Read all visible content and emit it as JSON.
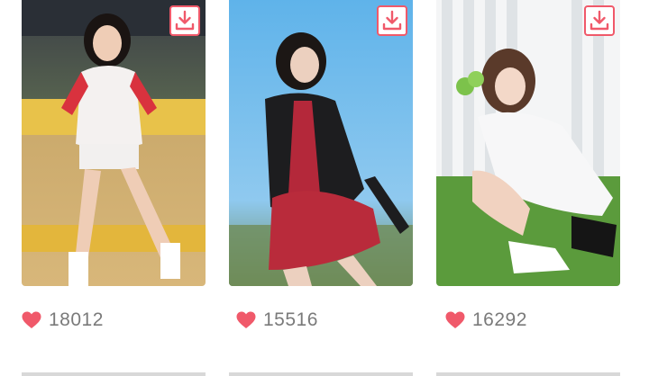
{
  "gallery": {
    "items": [
      {
        "likes": "18012",
        "download_icon": "download-icon",
        "like_icon": "heart-icon"
      },
      {
        "likes": "15516",
        "download_icon": "download-icon",
        "like_icon": "heart-icon"
      },
      {
        "likes": "16292",
        "download_icon": "download-icon",
        "like_icon": "heart-icon"
      }
    ]
  },
  "colors": {
    "accent": "#f0596a",
    "count_text": "#7a7a7a",
    "background": "#ffffff"
  }
}
